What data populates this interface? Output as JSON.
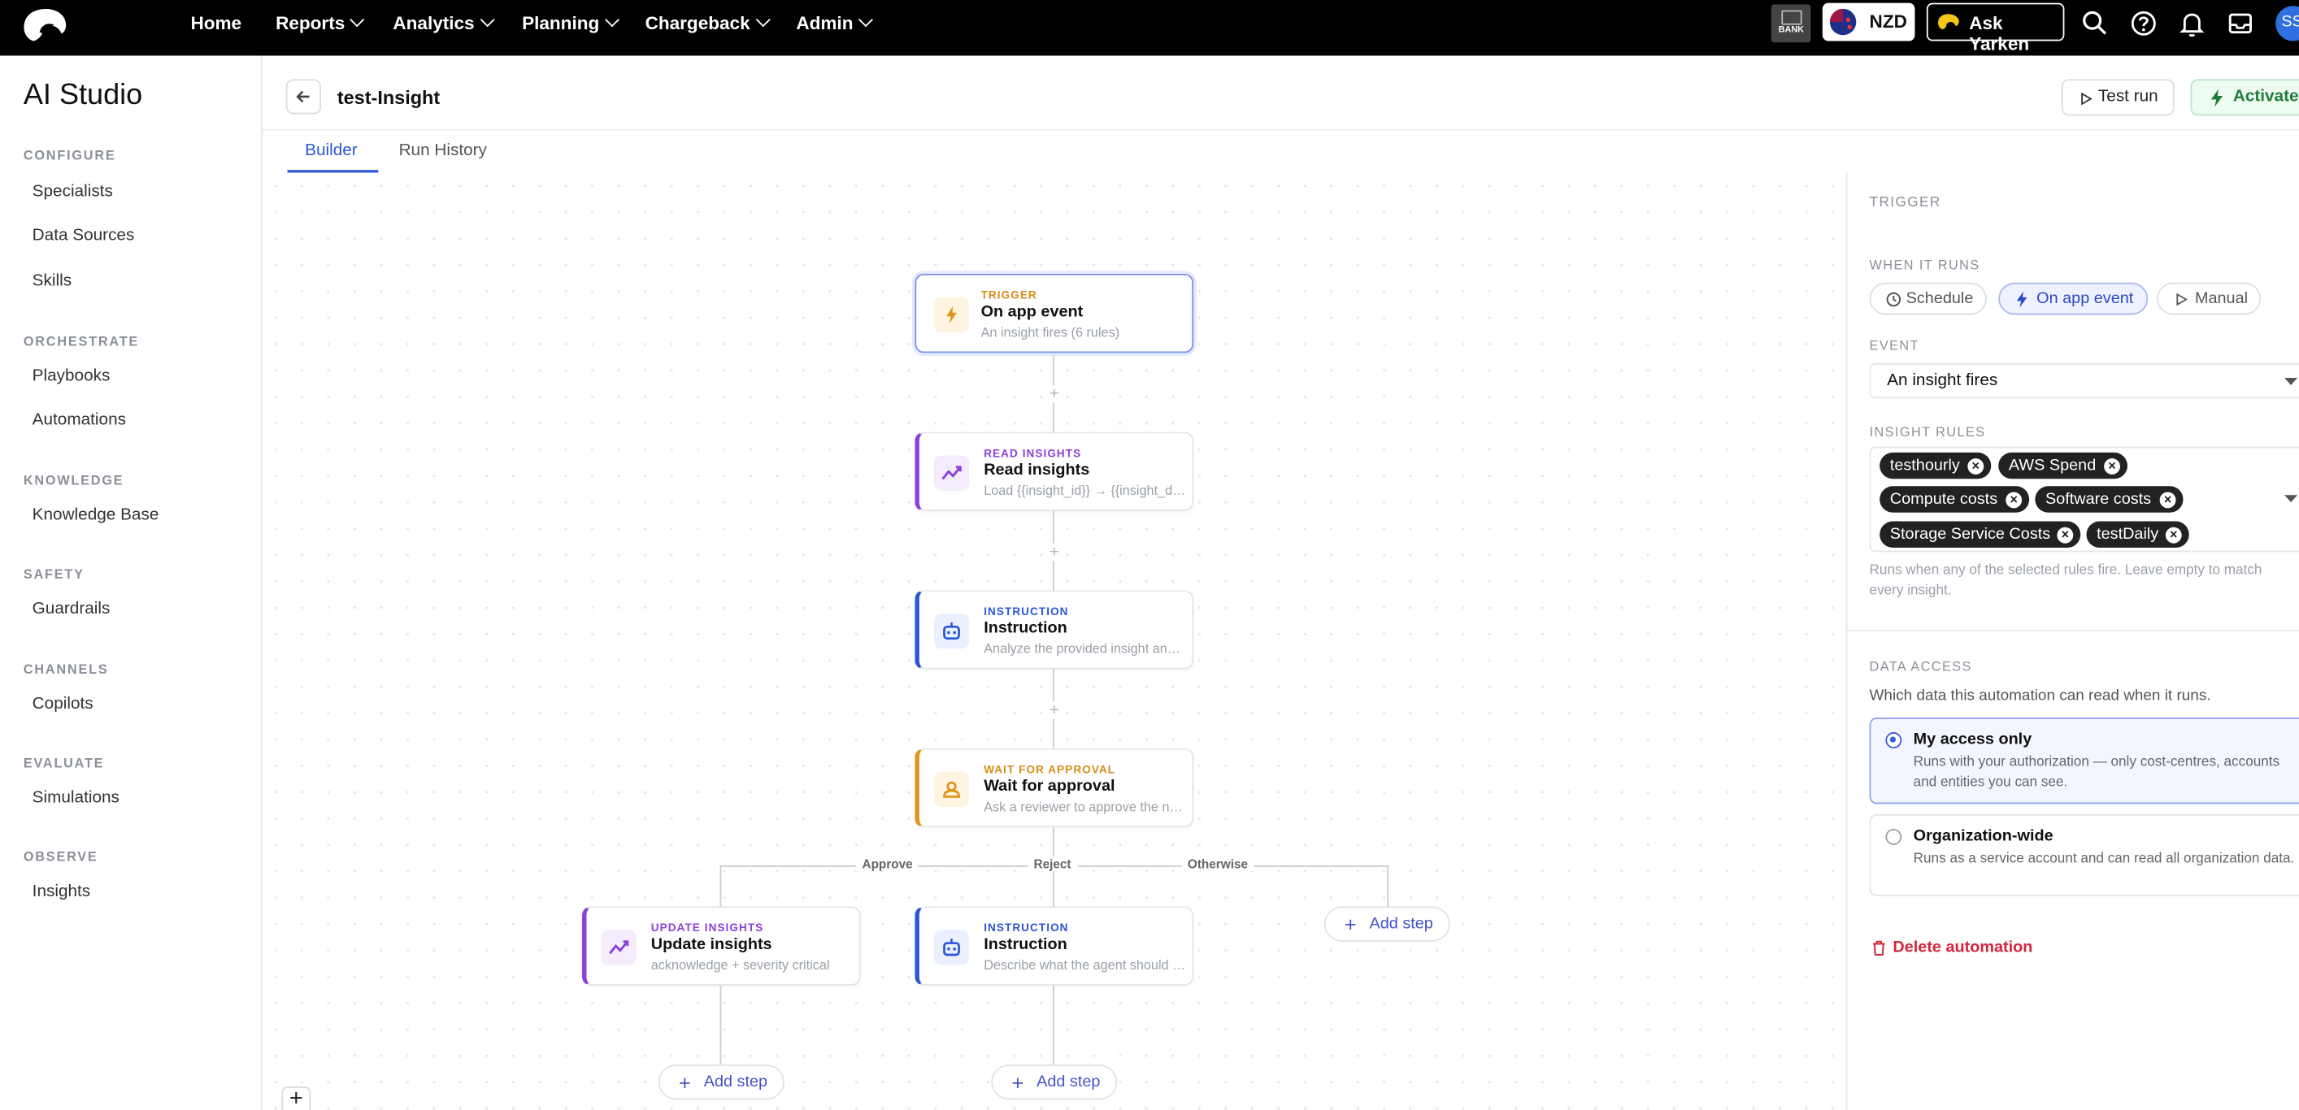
{
  "topnav": {
    "links": [
      "Home",
      "Reports",
      "Analytics",
      "Planning",
      "Chargeback",
      "Admin"
    ],
    "badge_text": "BANK",
    "currency": "NZD",
    "ask": "Ask Yarken",
    "avatar": "SS",
    "icons": [
      "search-icon",
      "help-icon",
      "bell-icon",
      "inbox-icon"
    ]
  },
  "sidebar": {
    "title": "AI Studio",
    "sections": [
      {
        "label": "CONFIGURE",
        "items": [
          "Specialists",
          "Data Sources",
          "Skills"
        ]
      },
      {
        "label": "ORCHESTRATE",
        "items": [
          "Playbooks",
          "Automations"
        ]
      },
      {
        "label": "KNOWLEDGE",
        "items": [
          "Knowledge Base"
        ]
      },
      {
        "label": "SAFETY",
        "items": [
          "Guardrails"
        ]
      },
      {
        "label": "CHANNELS",
        "items": [
          "Copilots"
        ]
      },
      {
        "label": "EVALUATE",
        "items": [
          "Simulations"
        ]
      },
      {
        "label": "OBSERVE",
        "items": [
          "Insights"
        ]
      }
    ]
  },
  "header": {
    "title": "test-Insight",
    "test_run": "Test run",
    "activate": "Activate"
  },
  "tabs": [
    "Builder",
    "Run History"
  ],
  "canvas": {
    "nodes": [
      {
        "kind": "TRIGGER",
        "title": "On app event",
        "subtitle": "An insight fires (6 rules)",
        "color": "#d98a14"
      },
      {
        "kind": "READ INSIGHTS",
        "title": "Read insights",
        "subtitle": "Load {{insight_id}} → {{insight_data}}",
        "color": "#8b3fd9"
      },
      {
        "kind": "INSTRUCTION",
        "title": "Instruction",
        "subtitle": "Analyze the provided insight and summarize",
        "color": "#2b55d6"
      },
      {
        "kind": "WAIT FOR APPROVAL",
        "title": "Wait for approval",
        "subtitle": "Ask a reviewer to approve the next step",
        "color": "#d98a14"
      },
      {
        "kind": "UPDATE INSIGHTS",
        "title": "Update insights",
        "subtitle": "acknowledge + severity critical",
        "color": "#8b3fd9"
      },
      {
        "kind": "INSTRUCTION",
        "title": "Instruction",
        "subtitle": "Describe what the agent should do",
        "color": "#2b55d6"
      }
    ],
    "branches": [
      "Approve",
      "Reject",
      "Otherwise"
    ],
    "add_step": "Add step"
  },
  "panel": {
    "section": "TRIGGER",
    "when_label": "WHEN IT RUNS",
    "when_options": [
      "Schedule",
      "On app event",
      "Manual"
    ],
    "when_selected": "On app event",
    "event_label": "EVENT",
    "event_value": "An insight fires",
    "rules_label": "INSIGHT RULES",
    "rules": [
      "testhourly",
      "AWS Spend",
      "Compute costs",
      "Software costs",
      "Storage Service Costs",
      "testDaily"
    ],
    "rules_help": "Runs when any of the selected rules fire. Leave empty to match every insight.",
    "access_label": "DATA ACCESS",
    "access_help": "Which data this automation can read when it runs.",
    "access_options": [
      {
        "title": "My access only",
        "desc": "Runs with your authorization — only cost-centres, accounts and entities you can see.",
        "selected": true
      },
      {
        "title": "Organization-wide",
        "desc": "Runs as a service account and can read all organization data.",
        "selected": false
      }
    ],
    "delete": "Delete automation"
  },
  "colors": {
    "accent": "#3b5bdb",
    "success": "#1e7e3a",
    "danger": "#d3263a",
    "nav_bg": "#000000"
  }
}
